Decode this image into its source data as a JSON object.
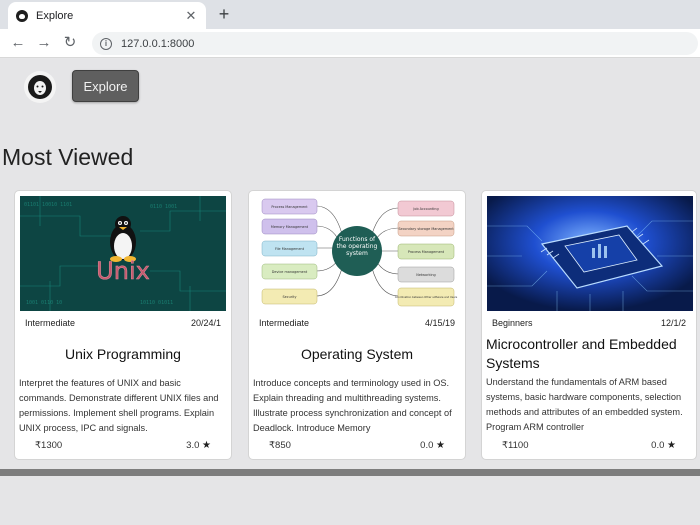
{
  "browser": {
    "tab_title": "Explore",
    "url": "127.0.0.1:8000",
    "close_glyph": "✕",
    "new_tab_glyph": "+",
    "back_glyph": "←",
    "forward_glyph": "→",
    "reload_glyph": "↻",
    "info_glyph": "i"
  },
  "header": {
    "explore_label": "Explore"
  },
  "section": {
    "title": "Most Viewed"
  },
  "cards": [
    {
      "image_icon": "unix-penguin-image",
      "image_text": "Unix",
      "level": "Intermediate",
      "date": "20/24/1",
      "title": "Unix Programming",
      "description": "Interpret the features of UNIX and basic commands. Demonstrate different UNIX files and permissions. Implement shell programs. Explain UNIX process, IPC and signals.",
      "price": "₹1300",
      "rating": "3.0",
      "rating_icon": "star-icon"
    },
    {
      "image_icon": "os-mindmap-image",
      "image_center": "Functions of the operating system",
      "image_left": [
        "Process Management",
        "Memory Management",
        "File Management",
        "Device management",
        "Security"
      ],
      "image_right": [
        "Job Accounting",
        "Secondary storage Management",
        "Process Management",
        "Networking",
        "Coordination between Other software and Users"
      ],
      "level": "Intermediate",
      "date": "4/15/19",
      "title": "Operating System",
      "description": "Introduce concepts and terminology used in OS. Explain threading and multithreading systems. Illustrate process synchronization and concept of Deadlock. Introduce Memory",
      "price": "₹850",
      "rating": "0.0",
      "rating_icon": "star-icon"
    },
    {
      "image_icon": "microcontroller-chip-image",
      "level": "Beginners",
      "date": "12/1/2",
      "title": "Microcontroller and Embedded Systems",
      "description": "Understand the fundamentals of ARM based systems, basic hardware components, selection methods and attributes of an embedded system. Program ARM controller",
      "price": "₹1100",
      "rating": "0.0",
      "rating_icon": "star-icon"
    }
  ],
  "colors": {
    "page_bg": "#e5e5e7",
    "button_bg": "#5f5f5f",
    "mindmap_center": "#1f5e55",
    "chip_blue": "#1f4fd0"
  }
}
